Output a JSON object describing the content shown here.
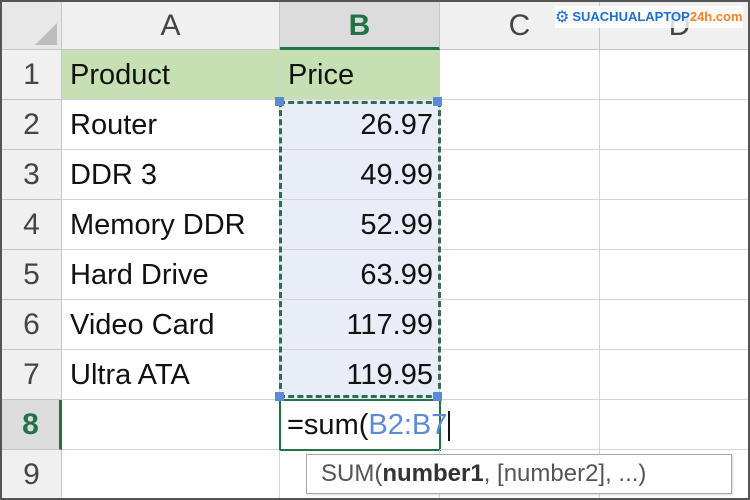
{
  "columns": [
    "A",
    "B",
    "C",
    "D"
  ],
  "active_column": "B",
  "rows": [
    "1",
    "2",
    "3",
    "4",
    "5",
    "6",
    "7",
    "8",
    "9"
  ],
  "active_row": "8",
  "table": {
    "headers": [
      "Product",
      "Price"
    ],
    "items": [
      {
        "product": "Router",
        "price": "26.97"
      },
      {
        "product": "DDR 3",
        "price": "49.99"
      },
      {
        "product": "Memory DDR",
        "price": "52.99"
      },
      {
        "product": "Hard Drive",
        "price": "63.99"
      },
      {
        "product": "Video Card",
        "price": "117.99"
      },
      {
        "product": "Ultra ATA",
        "price": "119.95"
      }
    ]
  },
  "formula": {
    "prefix": "=sum(",
    "range": "B2:B7"
  },
  "tooltip": {
    "fn": "SUM(",
    "arg1": "number1",
    "rest": ", [number2], ...)"
  },
  "watermark": {
    "brand": "SUACHUALAPTOP",
    "suffix": "24h.com"
  },
  "colors": {
    "accent": "#217346",
    "header_fill": "#c6e0b4",
    "reference": "#5b8bd6"
  }
}
